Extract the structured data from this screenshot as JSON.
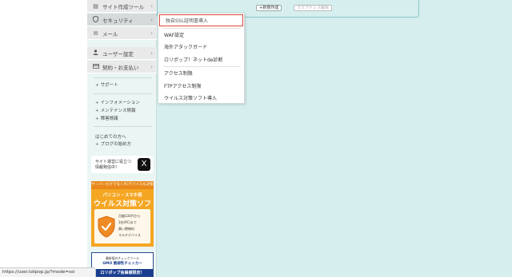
{
  "toolbar": {
    "button_new": "+新規作成",
    "button_bulk": "ラズアドレス解除"
  },
  "sidebar": {
    "items": [
      {
        "icon": "page-icon",
        "label": "サイト作成ツール",
        "arrow": "›"
      },
      {
        "icon": "shield-icon",
        "label": "セキュリティ",
        "arrow": "›"
      },
      {
        "icon": "mail-icon",
        "label": "メール",
        "arrow": "›"
      },
      {
        "icon": "user-icon",
        "label": "ユーザー設定",
        "arrow": "›"
      },
      {
        "icon": "card-icon",
        "label": "契約・お支払い",
        "arrow": "›"
      }
    ],
    "links": {
      "support": "サポート",
      "information": "インフォメーション",
      "maintenance": "メンテナンス情報",
      "outage": "障害情報",
      "beginners": "はじめての方へ",
      "blog_start": "ブログの始め方"
    },
    "bullet": "+",
    "x_banner": {
      "text": "サイト運営に役立つ\n情報発信中！",
      "logo": "X"
    },
    "virus_banner": {
      "top": "サーバーだけでなくPCデバイスも対策",
      "subtitle": "パソコン・スマホ用",
      "title": "ウイルス対策ソフト",
      "features": "月額330円から\n3台(PC)まで\n買い替無料\nマルチデバイス"
    },
    "gmo_banner": {
      "small": "最新版のチェックツール",
      "brand": "GMO 脆弱性チェッカー",
      "bar": "ロリポップ会員様限定！"
    }
  },
  "dropdown": {
    "items": [
      "独自SSL証明書導入",
      "WAF設定",
      "海外アタックガード",
      "ロリポップ！ネットde診断",
      "アクセス制限",
      "FTPアクセス制限",
      "ウイルス対策ソフト導入"
    ]
  },
  "statusbar": {
    "url": "https://user.lolipop.jp/?mode=ssl"
  },
  "colors": {
    "main_bg": "#d6eeee",
    "highlight_border": "#e0463a",
    "banner_orange": "#f5a623",
    "gmo_blue": "#1a3d8f"
  }
}
